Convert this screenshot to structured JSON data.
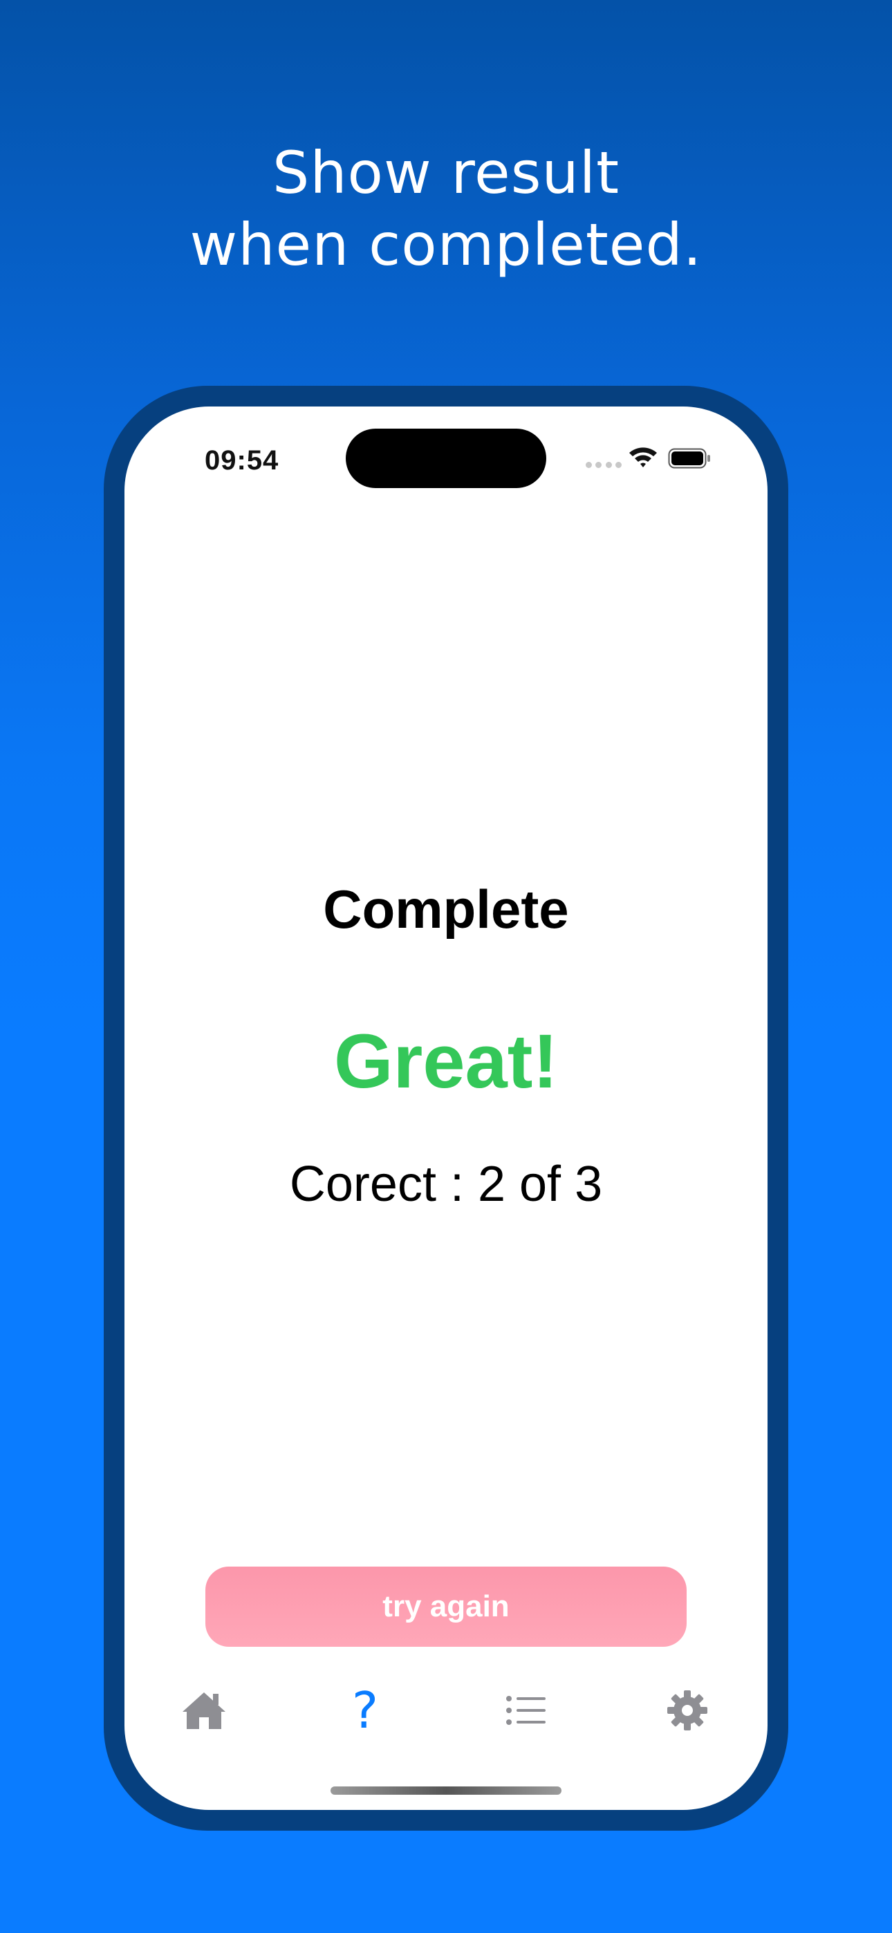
{
  "headline": {
    "line1": "Show result",
    "line2": "when completed."
  },
  "status_bar": {
    "time": "09:54",
    "wifi_icon": "wifi-icon",
    "battery_icon": "battery-full-icon"
  },
  "result": {
    "title": "Complete",
    "grade": "Great!",
    "score": "Corect : 2 of 3"
  },
  "actions": {
    "try_again_label": "try again"
  },
  "tab_bar": {
    "items": [
      {
        "icon": "home-icon",
        "selected": false
      },
      {
        "icon": "question-mark-icon",
        "glyph": "?",
        "selected": true
      },
      {
        "icon": "list-icon",
        "selected": false
      },
      {
        "icon": "gear-icon",
        "selected": false
      }
    ]
  },
  "colors": {
    "background_top": "#0452a8",
    "background_bottom": "#0a7cff",
    "phone_frame": "#06407f",
    "grade_green": "#34c759",
    "button_pink": "#ffa7b8",
    "tab_selected": "#0a7cff",
    "tab_inactive": "#8e8e93"
  }
}
